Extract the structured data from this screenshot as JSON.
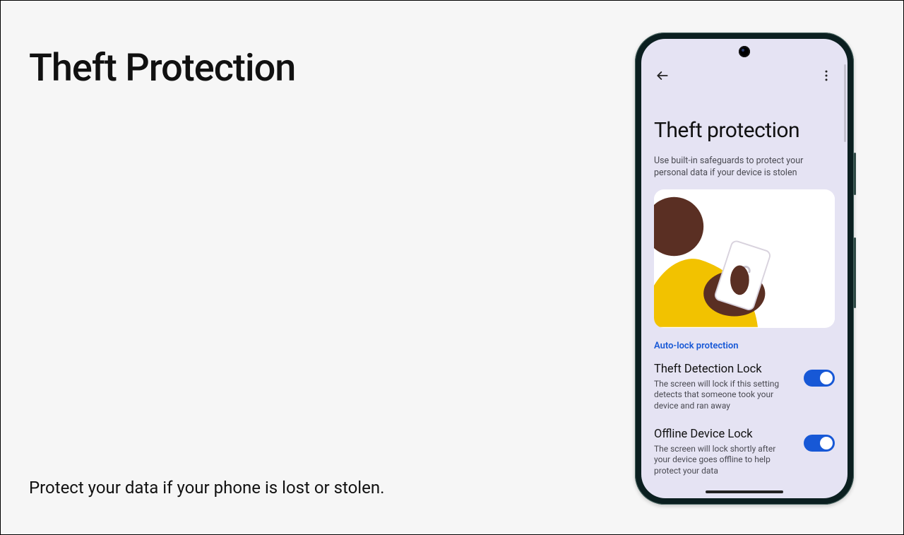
{
  "slide": {
    "title": "Theft Protection",
    "subtitle": "Protect your data if your phone is lost or stolen."
  },
  "phone": {
    "screen_title": "Theft protection",
    "screen_desc": "Use built-in safeguards to protect your personal data if your device is stolen",
    "section_label": "Auto-lock protection",
    "settings": [
      {
        "title": "Theft Detection Lock",
        "desc": "The screen will lock if this setting detects that someone took your device and ran away",
        "enabled": true
      },
      {
        "title": "Offline Device Lock",
        "desc": "The screen will lock shortly after your device goes offline to help protect your data",
        "enabled": true
      }
    ]
  }
}
